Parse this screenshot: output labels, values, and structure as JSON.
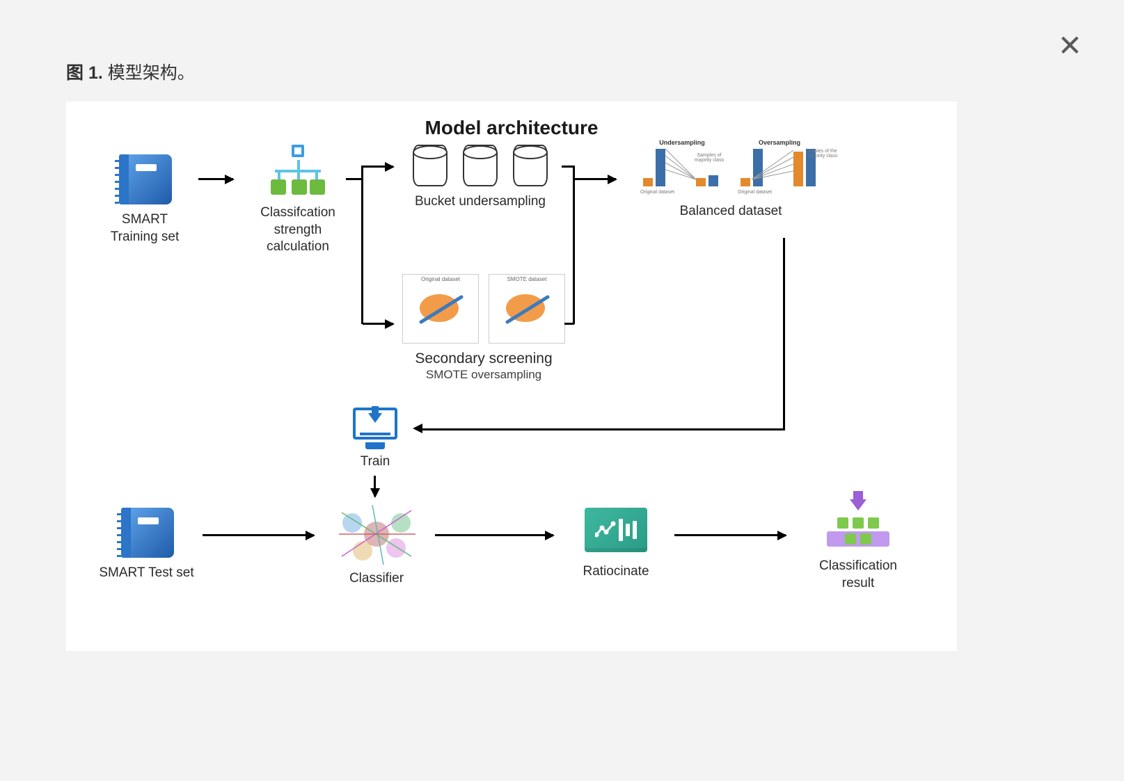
{
  "caption_bold": "图 1.",
  "caption_rest": " 模型架构。",
  "close": "✕",
  "diagram": {
    "title": "Model architecture",
    "nodes": {
      "training_set": "SMART\nTraining set",
      "calc": "Classifcation\nstrength\ncalculation",
      "bucket": "Bucket undersampling",
      "secondary_title": "Secondary screening",
      "secondary_sub": "SMOTE oversampling",
      "balanced": "Balanced dataset",
      "train": "Train",
      "test_set": "SMART Test set",
      "classifier": "Classifier",
      "ratiocinate": "Ratiocinate",
      "result": "Classification\nresult"
    },
    "mini": {
      "scatter_left": "Original dataset",
      "scatter_right": "SMOTE dataset",
      "undersampling": "Undersampling",
      "oversampling": "Oversampling",
      "orig_dataset": "Original dataset",
      "samples_majority": "Samples of\nmajority class",
      "copies_minority": "Copies of the\nminority class"
    }
  }
}
